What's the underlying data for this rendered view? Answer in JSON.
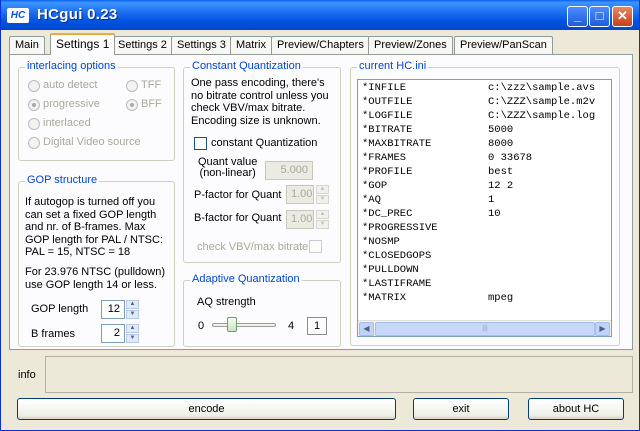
{
  "window": {
    "title": "HCgui 0.23",
    "icon_text": "HC",
    "minimize_glyph": "_",
    "maximize_glyph": "□",
    "close_glyph": "✕"
  },
  "tabs": [
    {
      "label": "Main"
    },
    {
      "label": "Settings 1"
    },
    {
      "label": "Settings 2"
    },
    {
      "label": "Settings 3"
    },
    {
      "label": "Matrix"
    },
    {
      "label": "Preview/Chapters"
    },
    {
      "label": "Preview/Zones"
    },
    {
      "label": "Preview/PanScan"
    }
  ],
  "active_tab": "Settings 1",
  "interlacing": {
    "title": "interlacing options",
    "auto_detect": "auto detect",
    "progressive": "progressive",
    "interlaced": "interlaced",
    "digital_video_source": "Digital Video source",
    "tff": "TFF",
    "bff": "BFF"
  },
  "gop": {
    "title": "GOP structure",
    "desc_lines": [
      "If autogop is turned off you",
      "can set a fixed GOP length",
      "and nr. of B-frames.  Max",
      "GOP length for PAL / NTSC:",
      "PAL = 15, NTSC = 18"
    ],
    "desc2_lines": [
      "For 23.976 NTSC (pulldown)",
      "use GOP length 14 or less."
    ],
    "gop_length_label": "GOP length",
    "gop_length_value": "12",
    "b_frames_label": "B frames",
    "b_frames_value": "2"
  },
  "cq": {
    "title": "Constant Quantization",
    "desc_lines": [
      "One pass encoding, there's",
      "no bitrate control unless you",
      "check VBV/max bitrate.",
      "Encoding size is unknown."
    ],
    "checkbox_label": "constant Quantization",
    "quant_label_1": "Quant value",
    "quant_label_2": "(non-linear)",
    "quant_value": "5.000",
    "pfactor_label": "P-factor for Quant",
    "pfactor_value": "1.00",
    "bfactor_label": "B-factor for Quant",
    "bfactor_value": "1.00",
    "vbv_label": "check VBV/max bitrate"
  },
  "aq": {
    "title": "Adaptive Quantization",
    "strength_label": "AQ strength",
    "min": "0",
    "max": "4",
    "value": "1"
  },
  "ini": {
    "title": "current HC.ini",
    "rows": [
      {
        "key": "*INFILE",
        "value": "c:\\zzz\\sample.avs"
      },
      {
        "key": "*OUTFILE",
        "value": "C:\\ZZZ\\sample.m2v"
      },
      {
        "key": "*LOGFILE",
        "value": "C:\\ZZZ\\sample.log"
      },
      {
        "key": "*BITRATE",
        "value": "5000"
      },
      {
        "key": "*MAXBITRATE",
        "value": "8000"
      },
      {
        "key": "*FRAMES",
        "value": "0 33678"
      },
      {
        "key": "*PROFILE",
        "value": "best"
      },
      {
        "key": "*GOP",
        "value": "12 2"
      },
      {
        "key": "*AQ",
        "value": "1"
      },
      {
        "key": "*DC_PREC",
        "value": "10"
      },
      {
        "key": "*PROGRESSIVE",
        "value": ""
      },
      {
        "key": "*NOSMP",
        "value": ""
      },
      {
        "key": "*CLOSEDGOPS",
        "value": ""
      },
      {
        "key": "*PULLDOWN",
        "value": ""
      },
      {
        "key": "*LASTIFRAME",
        "value": ""
      },
      {
        "key": "*MATRIX",
        "value": "mpeg"
      }
    ]
  },
  "info_label": "info",
  "buttons": {
    "encode": "encode",
    "exit": "exit",
    "about": "about HC"
  }
}
